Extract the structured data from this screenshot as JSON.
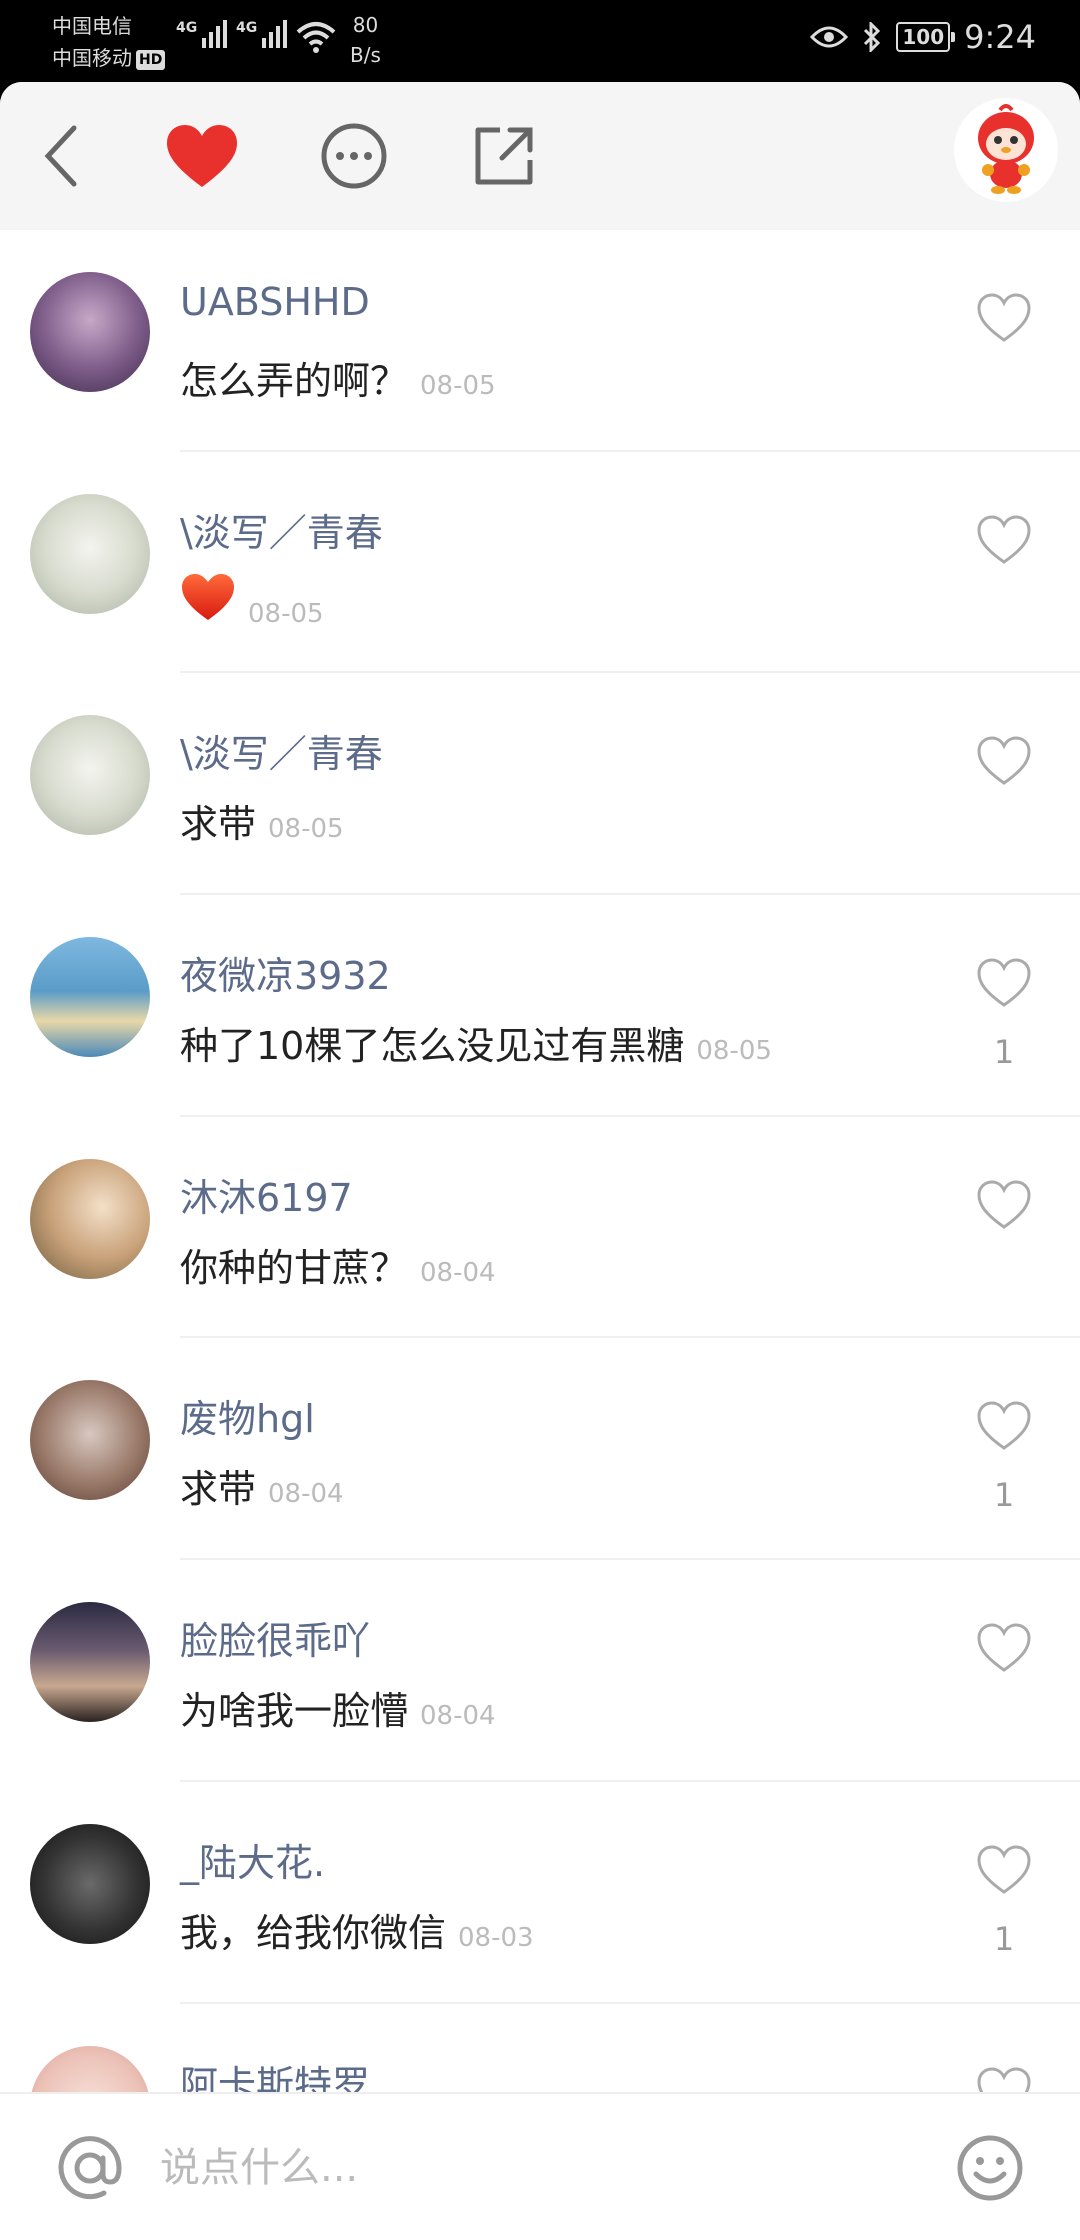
{
  "status_bar": {
    "carrier1": "中国电信",
    "carrier2": "中国移动",
    "hd_badge": "HD",
    "net_label_1": "4G",
    "net_label_2": "4G",
    "speed_value": "80",
    "speed_unit": "B/s",
    "battery": "100",
    "time": "9:24"
  },
  "comments": [
    {
      "name": "UABSHHD",
      "text": "怎么弄的啊？",
      "date": "08-05",
      "likes": "",
      "avatar": "avatar-purple-girl"
    },
    {
      "name": "\\淡写／青春",
      "text": "",
      "emoji": "red-heart-emoji",
      "date": "08-05",
      "likes": "",
      "avatar": "avatar-girl-bunny"
    },
    {
      "name": "\\淡写／青春",
      "text": "求带",
      "date": "08-05",
      "likes": "",
      "avatar": "avatar-girl-bunny"
    },
    {
      "name": "夜微凉3932",
      "text": "种了10棵了怎么没见过有黑糖",
      "date": "08-05",
      "likes": "1",
      "avatar": "avatar-beach-girl"
    },
    {
      "name": "沐沐6197",
      "text": "你种的甘蔗？",
      "date": "08-04",
      "likes": "",
      "avatar": "avatar-child-flowers"
    },
    {
      "name": "废物hgl",
      "text": "求带",
      "date": "08-04",
      "likes": "1",
      "avatar": "avatar-child-running"
    },
    {
      "name": "脸脸很乖吖",
      "text": "为啥我一脸懵",
      "date": "08-04",
      "likes": "",
      "avatar": "avatar-city-night"
    },
    {
      "name": "_陆大花.",
      "text": "我，给我你微信",
      "date": "08-03",
      "likes": "1",
      "avatar": "avatar-dark-portrait"
    },
    {
      "name": "阿卡斯特罗",
      "text": "",
      "date": "",
      "likes": "",
      "avatar": "avatar-pink-text"
    }
  ],
  "input": {
    "placeholder": "说点什么..."
  },
  "colors": {
    "accent_red": "#e8302c",
    "name_color": "#5c6b8a"
  }
}
